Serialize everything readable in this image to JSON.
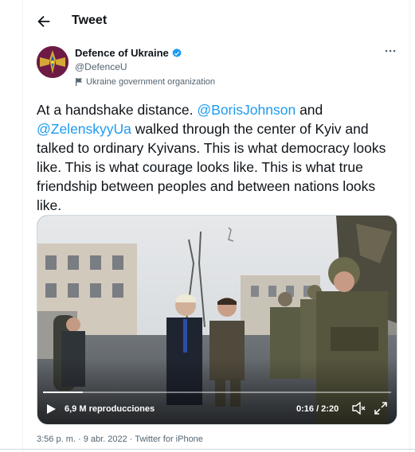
{
  "header": {
    "title": "Tweet"
  },
  "author": {
    "name": "Defence of Ukraine",
    "handle": "@DefenceU",
    "org_label": "Ukraine government organization"
  },
  "tweet": {
    "text_1": "At a handshake distance. ",
    "mention_1": "@BorisJohnson",
    "text_2": " and ",
    "mention_2": "@ZelenskyyUa",
    "text_3": " walked through the center of Kyiv and talked to ordinary Kyivans. This is what democracy looks like. This is what courage looks like. This is what true friendship between peoples and between nations looks like."
  },
  "video": {
    "views": "6,9 M reproducciones",
    "time": "0:16 / 2:20",
    "progress": 0.114
  },
  "meta": {
    "timestamp": "3:56 p. m. · 9 abr. 2022",
    "separator": " · ",
    "source": "Twitter for iPhone"
  },
  "colors": {
    "accent": "#1d9bf0",
    "text": "#0f1419",
    "secondary": "#536471",
    "avatar_bg": "#6d1b45"
  }
}
